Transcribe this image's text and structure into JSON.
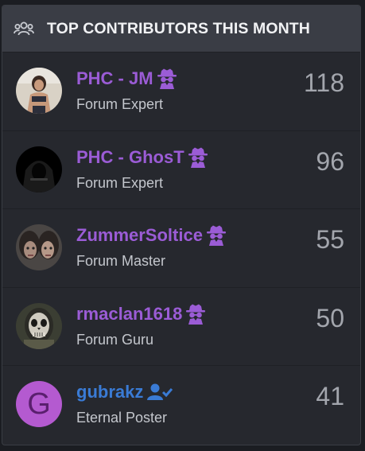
{
  "widget": {
    "title": "TOP CONTRIBUTORS THIS MONTH",
    "title_icon": "users-group-icon"
  },
  "contributors": [
    {
      "name": "PHC - JM",
      "rank": "Forum Expert",
      "count": "118",
      "badge": "spy-icon"
    },
    {
      "name": "PHC - GhosT",
      "rank": "Forum Expert",
      "count": "96",
      "badge": "spy-icon"
    },
    {
      "name": "ZummerSoltice",
      "rank": "Forum Master",
      "count": "55",
      "badge": "spy-icon"
    },
    {
      "name": "rmaclan1618",
      "rank": "Forum Guru",
      "count": "50",
      "badge": "spy-icon"
    },
    {
      "name": "gubrakz",
      "rank": "Eternal Poster",
      "count": "41",
      "badge": "user-check-icon",
      "avatar_letter": "G"
    }
  ],
  "colors": {
    "name_purple": "#9b5cd6",
    "name_blue": "#3a7bd5",
    "avatar_letter_bg": "#b45ad0"
  }
}
